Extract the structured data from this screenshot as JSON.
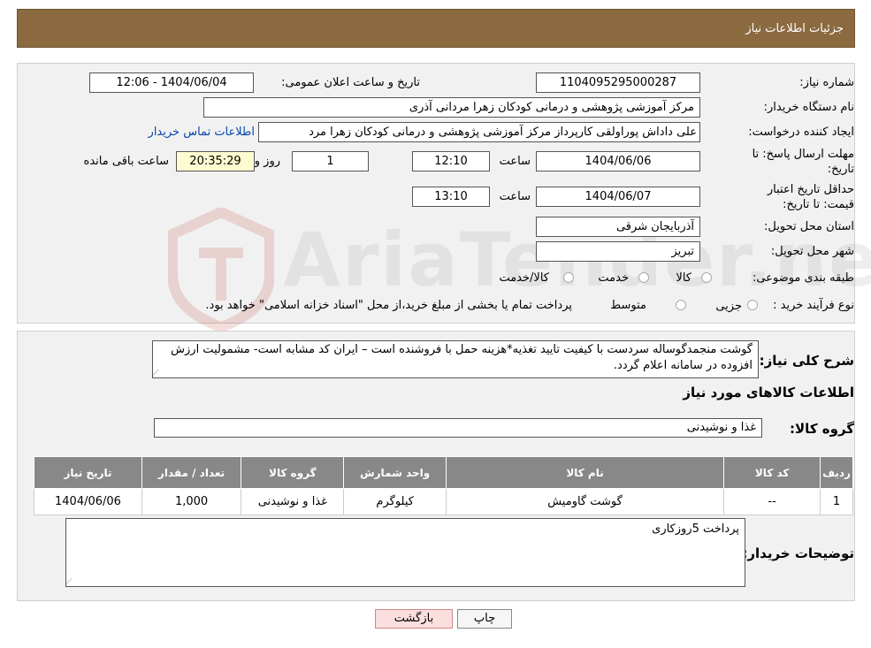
{
  "header": {
    "title": "جزئیات اطلاعات نیاز"
  },
  "fields": {
    "need_number_label": "شماره نیاز:",
    "need_number": "1104095295000287",
    "announce_label": "تاریخ و ساعت اعلان عمومی:",
    "announce_value": "1404/06/04 - 12:06",
    "buyer_label": "نام دستگاه خریدار:",
    "buyer_value": "مرکز آموزشی پژوهشی و درمانی کودکان زهرا مردانی آذری",
    "creator_label": "ایجاد کننده درخواست:",
    "creator_value": "علی داداش پوراولقی کارپرداز مرکز آموزشی پژوهشی و درمانی کودکان زهرا مرد",
    "contact_link": "اطلاعات تماس خریدار",
    "reply_deadline_label": "مهلت ارسال پاسخ: تا تاریخ:",
    "reply_date": "1404/06/06",
    "time_label": "ساعت",
    "reply_time": "12:10",
    "days_value": "1",
    "days_label": "روز و",
    "remaining_value": "20:35:29",
    "remaining_label": "ساعت باقی مانده",
    "validity_label": "حداقل تاریخ اعتبار قیمت: تا تاریخ:",
    "validity_date": "1404/06/07",
    "validity_time": "13:10",
    "province_label": "استان محل تحویل:",
    "province_value": "آذربایجان شرقی",
    "city_label": "شهر محل تحویل:",
    "city_value": "تبریز",
    "category_label": "طبقه بندی موضوعی:",
    "category_options": [
      "کالا",
      "خدمت",
      "کالا/خدمت"
    ],
    "process_label": "نوع فرآیند خرید :",
    "process_options": [
      "جزیی",
      "متوسط"
    ],
    "process_note": "پرداخت تمام یا بخشی از مبلغ خرید،از محل \"اسناد خزانه اسلامی\" خواهد بود."
  },
  "description": {
    "label": "شرح کلی نیاز:",
    "text": "گوشت منجمدگوساله  سردست  با کیفیت تایید تغذیه*هزینه حمل با فروشنده است – ایران کد مشابه است- مشمولیت ارزش افزوده در سامانه  اعلام  گردد."
  },
  "goods": {
    "section_title": "اطلاعات کالاهای مورد نیاز",
    "group_label": "گروه کالا:",
    "group_value": "غذا و نوشیدنی",
    "columns": [
      "ردیف",
      "کد کالا",
      "نام کالا",
      "واحد شمارش",
      "گروه کالا",
      "تعداد / مقدار",
      "تاریخ نیاز"
    ],
    "rows": [
      [
        "1",
        "--",
        "گوشت گاومیش",
        "کیلوگرم",
        "غذا و نوشیدنی",
        "1,000",
        "1404/06/06"
      ]
    ]
  },
  "buyer_notes": {
    "label": "توضیحات خریدار:",
    "text": "پرداخت 5روزکاری"
  },
  "buttons": {
    "print": "چاپ",
    "back": "بازگشت"
  },
  "watermark": "AriaTender.neT"
}
